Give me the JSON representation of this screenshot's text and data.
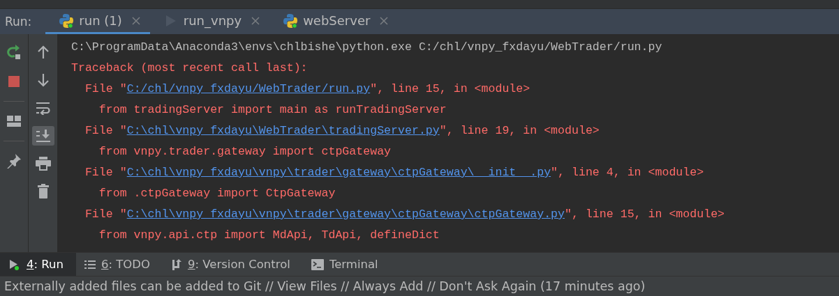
{
  "run_panel": {
    "label": "Run:",
    "tabs": [
      {
        "label": "run (1)",
        "kind": "python",
        "running": true,
        "selected": true
      },
      {
        "label": "run_vnpy",
        "kind": "play",
        "running": false,
        "selected": false
      },
      {
        "label": "webServer",
        "kind": "python",
        "running": true,
        "selected": false
      }
    ]
  },
  "console": {
    "lines": [
      {
        "kind": "plain",
        "text": "C:\\ProgramData\\Anaconda3\\envs\\chlbishe\\python.exe C:/chl/vnpy_fxdayu/WebTrader/run.py"
      },
      {
        "kind": "error",
        "text": "Traceback (most recent call last):"
      },
      {
        "kind": "file",
        "prefix": "  File \"",
        "link": "C:/chl/vnpy_fxdayu/WebTrader/run.py",
        "suffix": "\", line 15, in <module>"
      },
      {
        "kind": "error",
        "text": "    from tradingServer import main as runTradingServer"
      },
      {
        "kind": "file",
        "prefix": "  File \"",
        "link": "C:\\chl\\vnpy_fxdayu\\WebTrader\\tradingServer.py",
        "suffix": "\", line 19, in <module>"
      },
      {
        "kind": "error",
        "text": "    from vnpy.trader.gateway import ctpGateway"
      },
      {
        "kind": "file",
        "prefix": "  File \"",
        "link": "C:\\chl\\vnpy_fxdayu\\vnpy\\trader\\gateway\\ctpGateway\\__init__.py",
        "suffix": "\", line 4, in <module>"
      },
      {
        "kind": "error",
        "text": "    from .ctpGateway import CtpGateway"
      },
      {
        "kind": "file",
        "prefix": "  File \"",
        "link": "C:\\chl\\vnpy_fxdayu\\vnpy\\trader\\gateway\\ctpGateway\\ctpGateway.py",
        "suffix": "\", line 15, in <module>"
      },
      {
        "kind": "error",
        "text": "    from vnpy.api.ctp import MdApi, TdApi, defineDict"
      }
    ]
  },
  "tool_windows": [
    {
      "mnemonic": "4",
      "label": ": Run",
      "kind": "run",
      "selected": true
    },
    {
      "mnemonic": "6",
      "label": ": TODO",
      "kind": "list",
      "selected": false
    },
    {
      "mnemonic": "9",
      "label": ": Version Control",
      "kind": "vcs",
      "selected": false
    },
    {
      "label": "Terminal",
      "kind": "terminal",
      "selected": false
    }
  ],
  "status_bar": {
    "message": "Externally added files can be added to Git // View Files // Always Add // Don't Ask Again (17 minutes ago)"
  }
}
